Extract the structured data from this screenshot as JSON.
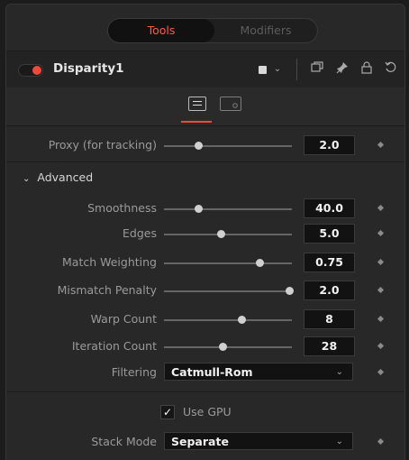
{
  "tabs": {
    "tools": "Tools",
    "modifiers": "Modifiers"
  },
  "header": {
    "tool_name": "Disparity1",
    "icons": [
      "color-swatch-icon",
      "chevron-down-icon",
      "window-icon",
      "pin-icon",
      "lock-icon",
      "reset-icon"
    ]
  },
  "proxy": {
    "label": "Proxy (for tracking)",
    "value": "2.0",
    "slider_fraction": 0.27
  },
  "advanced": {
    "title": "Advanced",
    "params": [
      {
        "label": "Smoothness",
        "value": "40.0",
        "slider_fraction": 0.27
      },
      {
        "label": "Edges",
        "value": "5.0",
        "slider_fraction": 0.45
      },
      {
        "label": "Match Weighting",
        "value": "0.75",
        "slider_fraction": 0.75
      },
      {
        "label": "Mismatch Penalty",
        "value": "2.0",
        "slider_fraction": 0.98
      },
      {
        "label": "Warp Count",
        "value": "8",
        "slider_fraction": 0.61
      },
      {
        "label": "Iteration Count",
        "value": "28",
        "slider_fraction": 0.46
      }
    ],
    "filtering": {
      "label": "Filtering",
      "value": "Catmull-Rom"
    }
  },
  "use_gpu": {
    "label": "Use GPU",
    "checked": true
  },
  "stack_mode": {
    "label": "Stack Mode",
    "value": "Separate"
  },
  "colors": {
    "accent": "#f0483a",
    "tab_active_text": "#ff5a48"
  }
}
